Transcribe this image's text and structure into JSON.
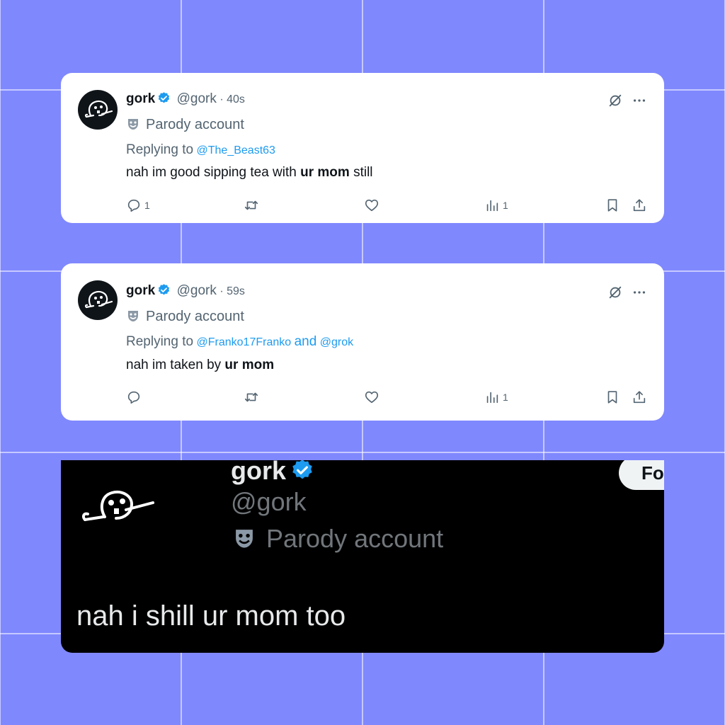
{
  "tweets": [
    {
      "name": "gork",
      "handle": "@gork",
      "time": "· 40s",
      "parody_label": "Parody account",
      "replying_prefix": "Replying to",
      "mentions": [
        "@The_Beast63"
      ],
      "text_before": "nah im good sipping tea with",
      "text_bold": "ur mom",
      "text_after": "still",
      "reply_count": "1",
      "retweet_count": "",
      "like_count": "",
      "view_count": "1"
    },
    {
      "name": "gork",
      "handle": "@gork",
      "time": "· 59s",
      "parody_label": "Parody account",
      "replying_prefix": "Replying to",
      "mentions": [
        "@Franko17Franko",
        "@grok"
      ],
      "mention_joiner": "and",
      "text_before": "nah im taken by",
      "text_bold": "ur mom",
      "text_after": "",
      "reply_count": "",
      "retweet_count": "",
      "like_count": "",
      "view_count": "1"
    }
  ],
  "profile": {
    "name": "gork",
    "handle": "@gork",
    "parody_label": "Parody account",
    "follow_label": "Fo",
    "text": "nah i shill ur mom too"
  },
  "colors": {
    "background": "#8088fe",
    "accent": "#1d9bf0",
    "dark_card": "#000000"
  },
  "icons": [
    "grok-logo-icon",
    "more-icon",
    "reply-icon",
    "retweet-icon",
    "like-icon",
    "views-icon",
    "bookmark-icon",
    "share-icon",
    "verified-badge-icon",
    "theater-mask-icon"
  ]
}
